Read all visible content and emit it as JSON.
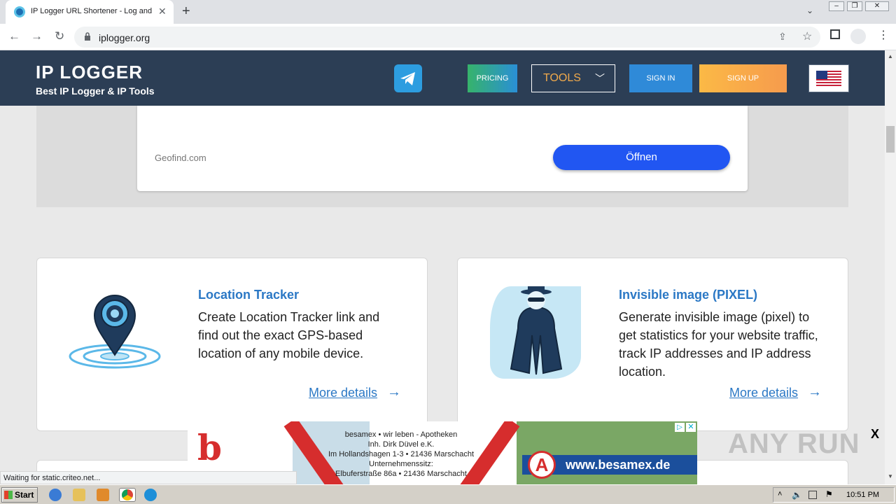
{
  "browser": {
    "tab_title": "IP Logger URL Shortener - Log and T",
    "url": "iplogger.org",
    "status_text": "Waiting for static.criteo.net..."
  },
  "header": {
    "logo": "IP LOGGER",
    "tagline": "Best IP Logger & IP Tools",
    "pricing": "PRICING",
    "tools": "TOOLS",
    "signin": "SIGN IN",
    "signup": "SIGN UP"
  },
  "ad": {
    "domain": "Geofind.com",
    "open_label": "Öffnen"
  },
  "features": [
    {
      "title": "Location Tracker",
      "description": "Create Location Tracker link and find out the exact GPS-based location of any mobile device.",
      "more": "More details"
    },
    {
      "title": "Invisible image (PIXEL)",
      "description": "Generate invisible image (pixel) to get statistics for your website traffic, track IP addresses and IP address location.",
      "more": "More details"
    }
  ],
  "banner": {
    "line1": "besamex • wir leben - Apotheken",
    "line2": "Inh. Dirk Düvel e.K.",
    "line3": "Im Hollandshagen 1-3 • 21436 Marschacht",
    "line4": "Unternehmenssitz:",
    "line5": "Elbuferstraße 86a • 21436 Marschacht",
    "url": "www.besamex.de"
  },
  "watermark": "ANY RUN",
  "taskbar": {
    "start": "Start",
    "clock": "10:51 PM"
  },
  "colors": {
    "header_bg": "#2c3e55",
    "accent_blue": "#2b78c5",
    "ad_button": "#2156f2"
  }
}
